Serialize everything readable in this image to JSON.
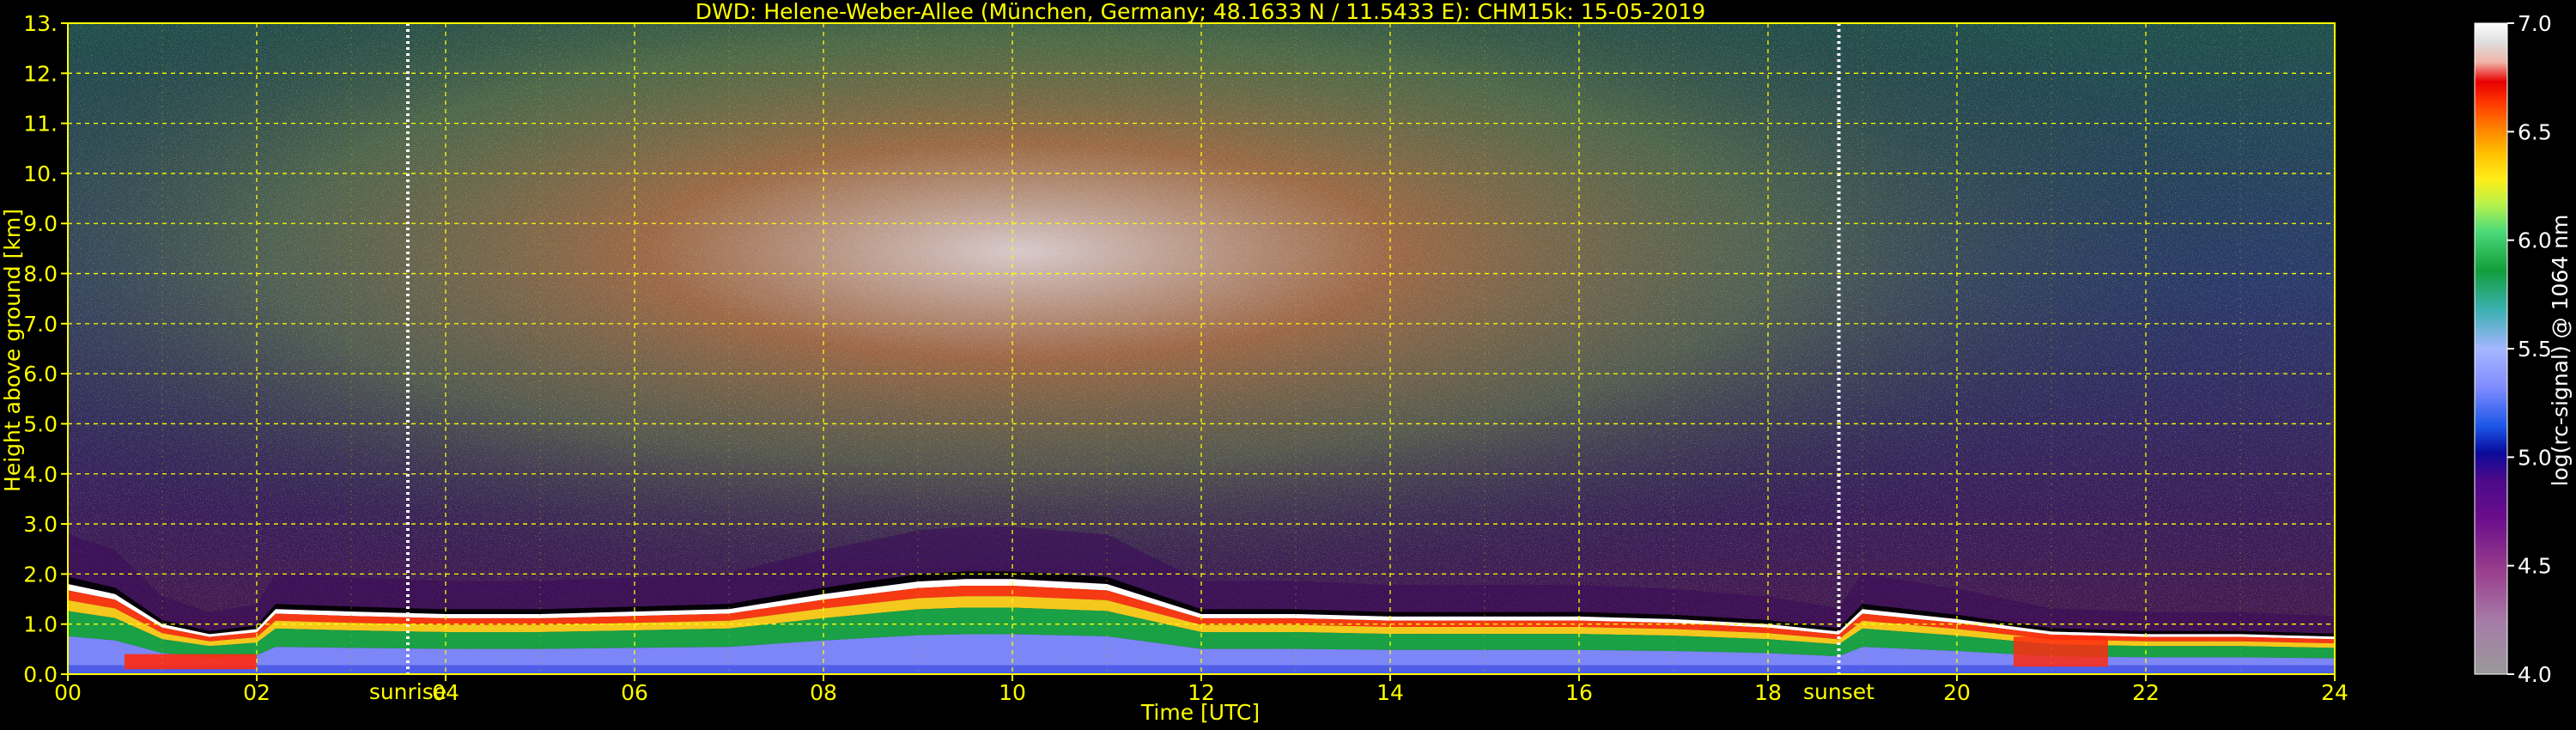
{
  "chart_data": {
    "type": "heatmap",
    "title": "DWD: Helene-Weber-Allee (München, Germany; 48.1633 N / 11.5433 E):    CHM15k: 15-05-2019",
    "xlabel": "Time [UTC]",
    "ylabel": "Height above ground [km]",
    "xlim": [
      0,
      24
    ],
    "ylim": [
      0,
      13
    ],
    "x_ticks": [
      "00",
      "02",
      "04",
      "06",
      "08",
      "10",
      "12",
      "14",
      "16",
      "18",
      "20",
      "22",
      "24"
    ],
    "y_ticks": [
      "0.0",
      "1.0",
      "2.0",
      "3.0",
      "4.0",
      "5.0",
      "6.0",
      "7.0",
      "8.0",
      "9.0",
      "10.",
      "11.",
      "12.",
      "13."
    ],
    "grid": true,
    "annotations": [
      {
        "text": "sunrise",
        "x": 3.6
      },
      {
        "text": "sunset",
        "x": 18.75
      }
    ],
    "colorbar": {
      "label": "log(rc-signal) @ 1064 nm",
      "range": [
        4.0,
        7.0
      ],
      "ticks": [
        "4.0",
        "4.5",
        "5.0",
        "5.5",
        "6.0",
        "6.5",
        "7.0"
      ]
    },
    "boundary_layer_top_km": {
      "x": [
        0.0,
        0.5,
        1.0,
        1.5,
        2.0,
        2.2,
        3,
        4,
        5,
        6,
        7,
        8,
        9,
        9.5,
        10,
        11,
        12,
        13,
        14,
        15,
        16,
        17,
        18,
        18.75,
        19,
        20,
        21,
        22,
        23,
        24
      ],
      "y": [
        1.8,
        1.6,
        1.0,
        0.8,
        0.9,
        1.3,
        1.25,
        1.2,
        1.2,
        1.25,
        1.3,
        1.6,
        1.85,
        1.9,
        1.9,
        1.8,
        1.2,
        1.2,
        1.15,
        1.15,
        1.15,
        1.1,
        1.0,
        0.85,
        1.3,
        1.1,
        0.85,
        0.8,
        0.8,
        0.75
      ]
    }
  }
}
